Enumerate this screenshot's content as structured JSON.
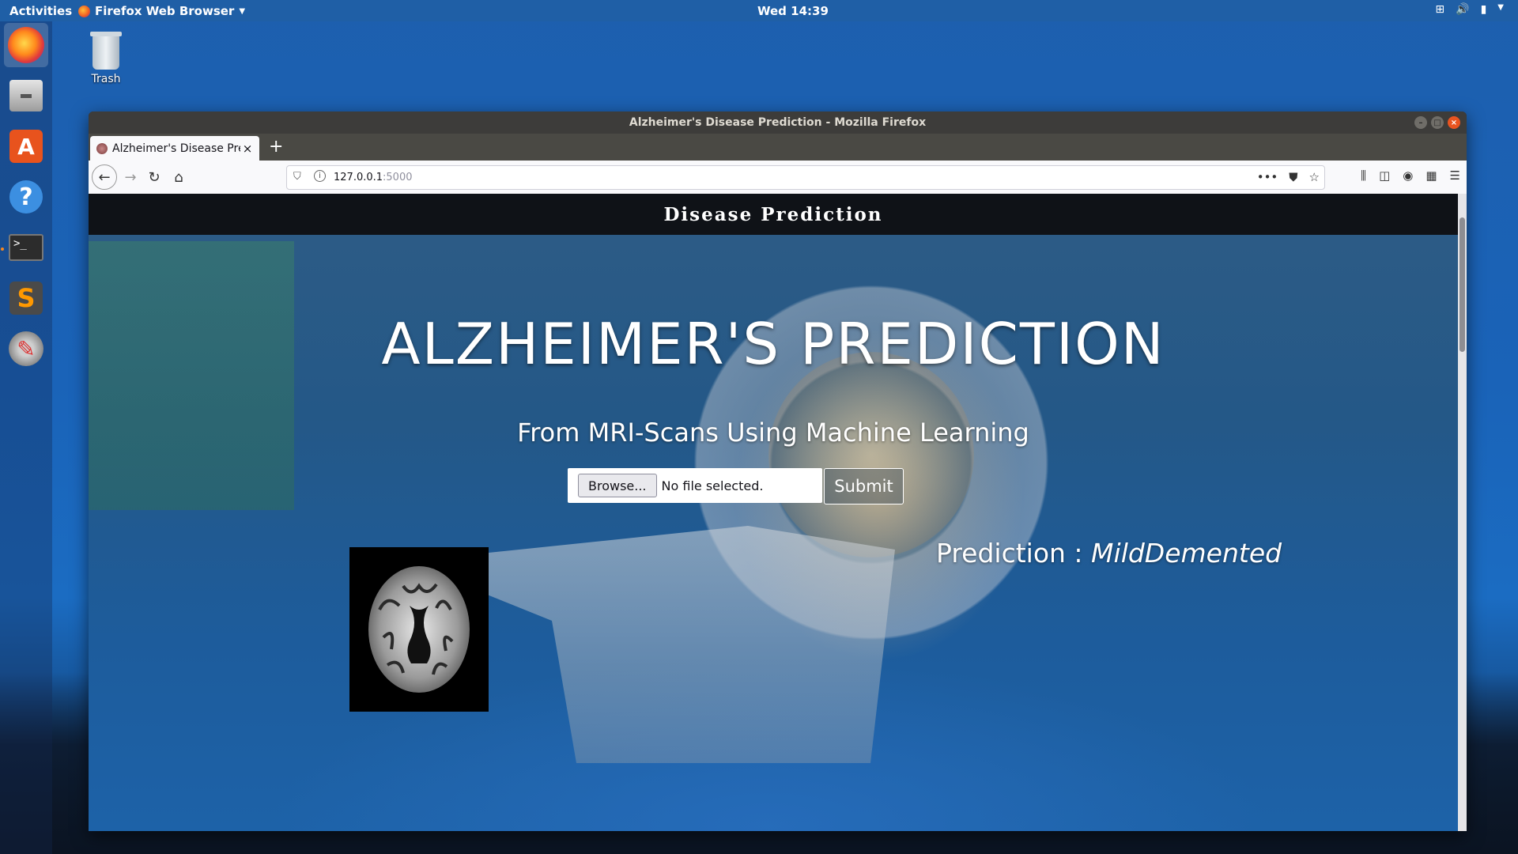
{
  "topbar": {
    "activities": "Activities",
    "app_menu": "Firefox Web Browser",
    "clock": "Wed 14:39"
  },
  "dock": {
    "items": [
      "firefox",
      "files",
      "software-center",
      "help",
      "terminal",
      "sublime-text",
      "system-tools"
    ]
  },
  "desktop": {
    "trash_label": "Trash"
  },
  "window": {
    "title": "Alzheimer's Disease Prediction - Mozilla Firefox",
    "tab_label": "Alzheimer's Disease Prediction",
    "url_host": "127.0.0.1",
    "url_port": ":5000"
  },
  "page": {
    "brand": "Disease Prediction",
    "hero_title": "ALZHEIMER'S PREDICTION",
    "hero_subtitle": "From MRI-Scans Using Machine Learning",
    "browse_label": "Browse...",
    "file_status": "No file selected.",
    "submit_label": "Submit",
    "prediction_label": "Prediction : ",
    "prediction_value": "MildDemented"
  },
  "colors": {
    "desktop_blue": "#1d5fae",
    "ubuntu_orange": "#e95420",
    "header_dark": "#0f1217"
  }
}
